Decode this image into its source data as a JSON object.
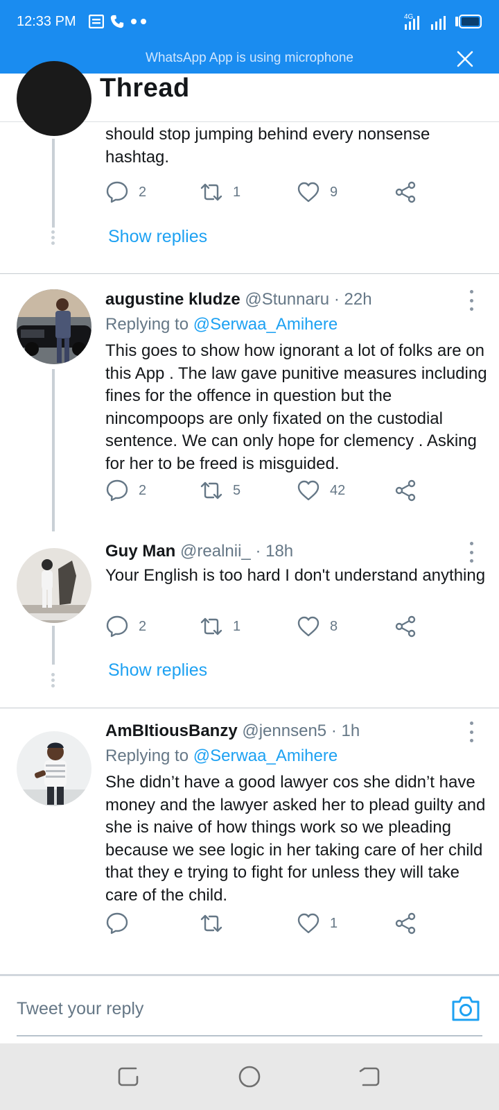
{
  "status_bar": {
    "time": "12:33 PM",
    "network_label": "4G",
    "bg_color": "#1a8cf0"
  },
  "mic_banner": {
    "text": "WhatsApp App is using microphone"
  },
  "header": {
    "title": "Thread"
  },
  "thread": {
    "partial_tweet": {
      "text": "should stop jumping behind every nonsense hashtag.",
      "actions": {
        "replies": "2",
        "retweets": "1",
        "likes": "9"
      },
      "show_replies": "Show replies"
    },
    "tweets": [
      {
        "name": "augustine kludze",
        "handle": "@Stunnaru",
        "time": "22h",
        "replying_prefix": "Replying to ",
        "replying_to": "@Serwaa_Amihere",
        "text": "This goes to show how ignorant a lot of folks are on this App . The law gave punitive measures including fines for the offence in question but the nincompoops are only fixated on the custodial sentence. We can only hope for clemency . Asking for her to be freed is misguided.",
        "actions": {
          "replies": "2",
          "retweets": "5",
          "likes": "42"
        }
      },
      {
        "name": "Guy Man",
        "handle": "@realnii_",
        "time": "18h",
        "text": "Your English is too hard I don't understand anything",
        "actions": {
          "replies": "2",
          "retweets": "1",
          "likes": "8"
        },
        "show_replies": "Show replies"
      },
      {
        "name": "AmBItiousBanzy",
        "handle": "@jennsen5",
        "time": "1h",
        "replying_prefix": "Replying to ",
        "replying_to": "@Serwaa_Amihere",
        "text": "She didn’t have a good lawyer cos she didn’t have money and the lawyer asked her to plead guilty and she is naive of how things work so we pleading because we see logic in her taking care of her child that they e trying to fight for unless they will take care of the child.",
        "actions": {
          "replies": "",
          "retweets": "",
          "likes": "1"
        }
      }
    ]
  },
  "composer": {
    "placeholder": "Tweet your reply"
  },
  "colors": {
    "accent": "#1da1f2",
    "muted": "#657786",
    "text": "#14171a"
  }
}
